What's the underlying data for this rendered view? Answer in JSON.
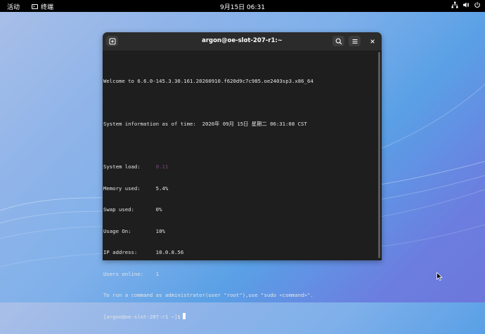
{
  "topbar": {
    "activities": "活动",
    "app_name": "终端",
    "clock": "9月15日  06:31"
  },
  "window": {
    "title": "argon@oe-slot-207-r1:~"
  },
  "terminal": {
    "welcome": "Welcome to 6.6.0-145.3.30.161.20260910.f620d9c7c985.oe2403sp3.x86_64",
    "sysinfo": "System information as of time:  2026年 09月 15日 星期二 06:31:08 CST",
    "load_label": "System load:     ",
    "load_value": "0.11",
    "memory": "Memory used:     5.4%",
    "swap": "Swap used:       0%",
    "usage": "Usage On:        10%",
    "ip": "IP address:      10.0.8.56",
    "users": "Users online:    1",
    "hint": "To run a command as administrator(user \"root\"),use \"sudo <command>\".",
    "prompt": "[argon@oe-slot-207-r1 ~]$"
  },
  "icons": {
    "new_tab": "new-tab-icon",
    "search": "search-icon",
    "menu": "hamburger-menu-icon",
    "close": "close-icon",
    "network": "network-icon",
    "volume": "volume-icon",
    "power": "power-icon"
  },
  "colors": {
    "desktop_accent": "#5aa0e6",
    "terminal_bg": "#1e1e1e",
    "load_value": "#7a4a7f"
  }
}
